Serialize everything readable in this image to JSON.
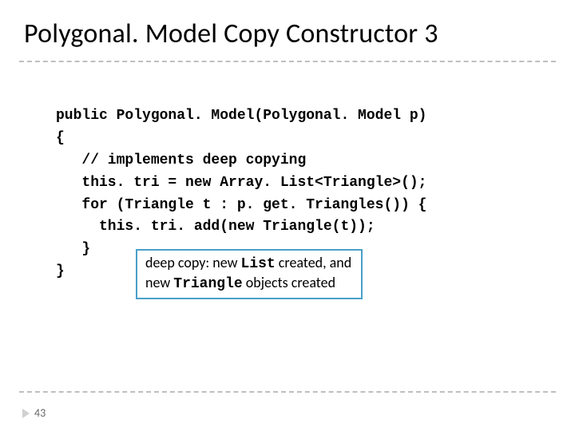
{
  "title": "Polygonal. Model Copy Constructor 3",
  "code": {
    "l1": "public Polygonal. Model(Polygonal. Model p)",
    "l2": "{",
    "l3": "   // implements deep copying",
    "l4": "   this. tri = new Array. List<Triangle>();",
    "l5": "   for (Triangle t : p. get. Triangles()) {",
    "l6": "     this. tri. add(new Triangle(t));",
    "l7": "   }",
    "l8": "}"
  },
  "callout": {
    "part1": "deep copy: new ",
    "mono1": "List",
    "part2": " created, and new ",
    "mono2": "Triangle",
    "part3": " objects created"
  },
  "page_number": "43"
}
